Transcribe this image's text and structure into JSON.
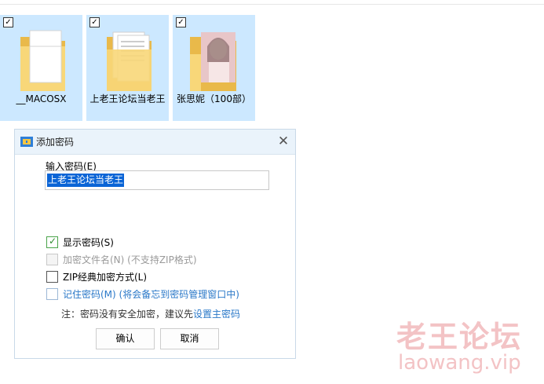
{
  "files": [
    {
      "name": "__MACOSX",
      "checked": true,
      "type": "folder-blank"
    },
    {
      "name": "上老王论坛当老王",
      "checked": true,
      "type": "folder-docs"
    },
    {
      "name": "张思妮（100部）",
      "checked": true,
      "type": "folder-photo"
    }
  ],
  "dialog": {
    "title": "添加密码",
    "password_label": "输入密码(E)",
    "password_value": "上老王论坛当老王",
    "options": [
      {
        "label": "显示密码(S)",
        "checked": true,
        "enabled": true
      },
      {
        "label": "加密文件名(N) (不支持ZIP格式)",
        "checked": false,
        "enabled": false
      },
      {
        "label": "ZIP经典加密方式(L)",
        "checked": false,
        "enabled": true
      },
      {
        "label": "记住密码(M) (将会备忘到密码管理窗口中)",
        "checked": false,
        "enabled": true
      }
    ],
    "note_prefix": "注：密码没有安全加密，建议先",
    "note_link": "设置主密码",
    "ok_label": "确认",
    "cancel_label": "取消"
  },
  "watermark": {
    "title": "老王论坛",
    "url": "laowang.vip"
  },
  "colors": {
    "selection": "#cce8ff",
    "link": "#2a78c8",
    "watermark": "#f3c3c5"
  }
}
